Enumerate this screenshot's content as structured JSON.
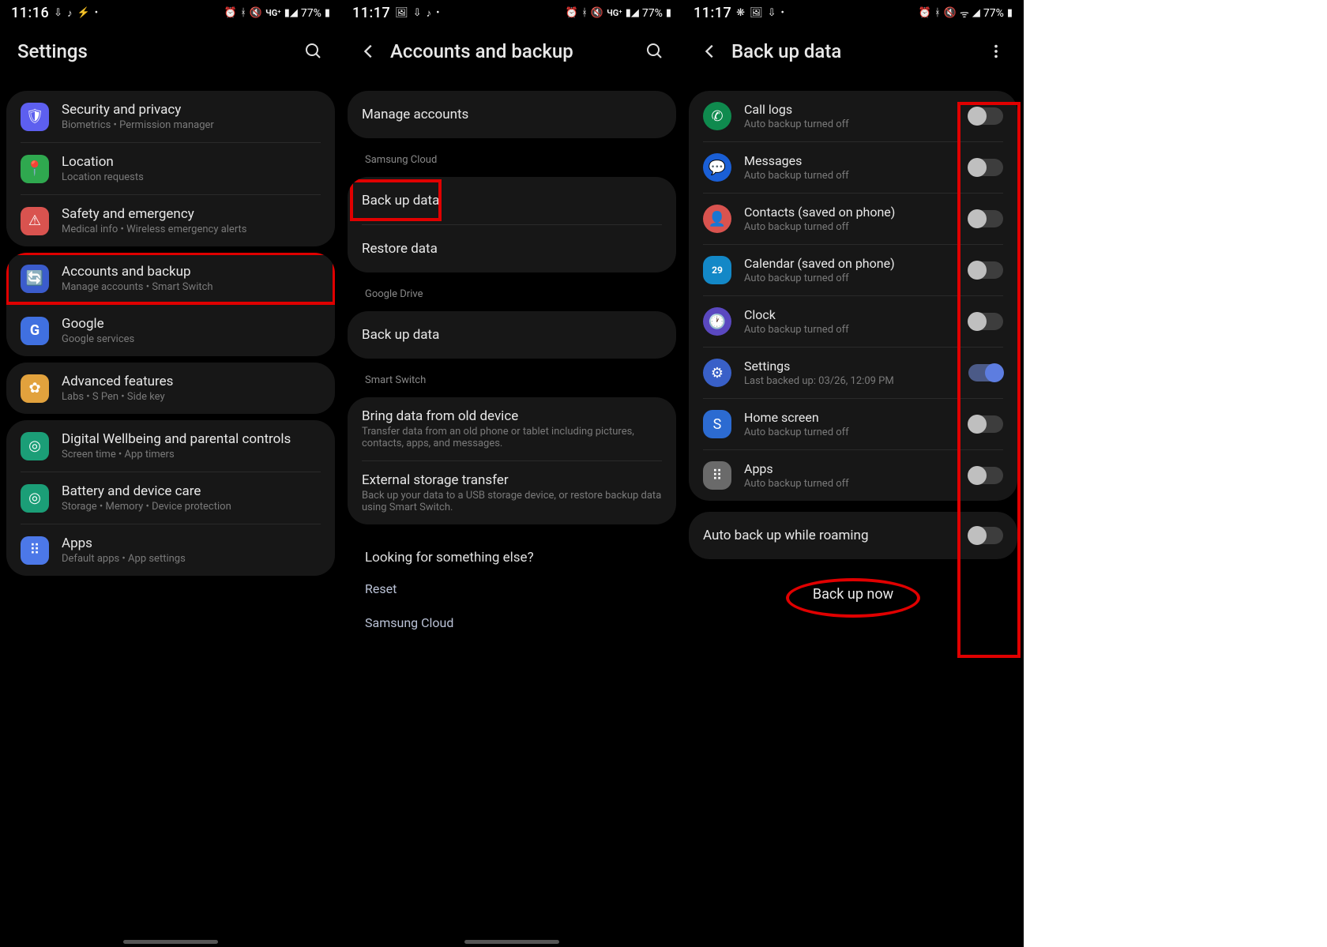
{
  "screen1": {
    "time": "11:16",
    "battery": "77%",
    "title": "Settings",
    "groups": [
      {
        "items": [
          {
            "icon": "shield",
            "title": "Security and privacy",
            "sub": "Biometrics  •  Permission manager"
          },
          {
            "icon": "pin",
            "title": "Location",
            "sub": "Location requests"
          },
          {
            "icon": "alert",
            "title": "Safety and emergency",
            "sub": "Medical info  •  Wireless emergency alerts"
          }
        ]
      },
      {
        "items": [
          {
            "icon": "sync",
            "title": "Accounts and backup",
            "sub": "Manage accounts  •  Smart Switch",
            "highlight": true
          },
          {
            "icon": "google",
            "title": "Google",
            "sub": "Google services"
          }
        ]
      },
      {
        "items": [
          {
            "icon": "gearY",
            "title": "Advanced features",
            "sub": "Labs  •  S Pen  •  Side key"
          }
        ]
      },
      {
        "items": [
          {
            "icon": "wellbeing",
            "title": "Digital Wellbeing and parental controls",
            "sub": "Screen time  •  App timers"
          },
          {
            "icon": "battery",
            "title": "Battery and device care",
            "sub": "Storage  •  Memory  •  Device protection"
          },
          {
            "icon": "apps",
            "title": "Apps",
            "sub": "Default apps  •  App settings"
          }
        ]
      }
    ]
  },
  "screen2": {
    "time": "11:17",
    "battery": "77%",
    "title": "Accounts and backup",
    "manage": "Manage accounts",
    "sec_samsung": "Samsung Cloud",
    "backup": "Back up data",
    "restore": "Restore data",
    "sec_gdrive": "Google Drive",
    "g_backup": "Back up data",
    "sec_ss": "Smart Switch",
    "bring_title": "Bring data from old device",
    "bring_sub": "Transfer data from an old phone or tablet including pictures, contacts, apps, and messages.",
    "ext_title": "External storage transfer",
    "ext_sub": "Back up your data to a USB storage device, or restore backup data using Smart Switch.",
    "looking": "Looking for something else?",
    "link_reset": "Reset",
    "link_cloud": "Samsung Cloud"
  },
  "screen3": {
    "time": "11:17",
    "battery": "77%",
    "title": "Back up data",
    "items": [
      {
        "icon": "call",
        "title": "Call logs",
        "sub": "Auto backup turned off",
        "on": false
      },
      {
        "icon": "msg",
        "title": "Messages",
        "sub": "Auto backup turned off",
        "on": false
      },
      {
        "icon": "contact",
        "title": "Contacts (saved on phone)",
        "sub": "Auto backup turned off",
        "on": false
      },
      {
        "icon": "cal",
        "title": "Calendar (saved on phone)",
        "sub": "Auto backup turned off",
        "on": false
      },
      {
        "icon": "clock",
        "title": "Clock",
        "sub": "Auto backup turned off",
        "on": false
      },
      {
        "icon": "gearB",
        "title": "Settings",
        "sub": "Last backed up: 03/26, 12:09 PM",
        "on": true
      },
      {
        "icon": "home",
        "title": "Home screen",
        "sub": "Auto backup turned off",
        "on": false
      },
      {
        "icon": "grid",
        "title": "Apps",
        "sub": "Auto backup turned off",
        "on": false
      }
    ],
    "roaming": "Auto back up while roaming",
    "backup_now": "Back up now"
  },
  "icons": {
    "shield": "🛡",
    "pin": "📍",
    "alert": "⚠",
    "sync": "🔄",
    "google": "G",
    "gearY": "✿",
    "wellbeing": "◎",
    "battery": "◎",
    "apps": "⠿",
    "call": "✆",
    "msg": "💬",
    "contact": "👤",
    "cal": "29",
    "clock": "🕐",
    "gearB": "⚙",
    "home": "S",
    "grid": "⠿"
  }
}
